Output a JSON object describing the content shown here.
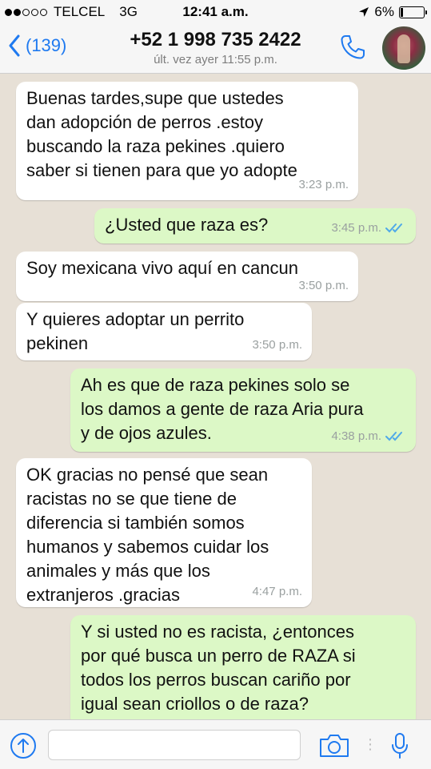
{
  "status_bar": {
    "carrier": "TELCEL",
    "network": "3G",
    "time": "12:41 a.m.",
    "battery": "6%"
  },
  "header": {
    "back_count": "(139)",
    "contact_name": "+52 1 998 735 2422",
    "last_seen": "últ. vez ayer 11:55 p.m."
  },
  "messages": [
    {
      "direction": "in",
      "text": "Buenas tardes,supe que ustedes\ndan adopción de perros  .estoy\nbuscando la raza pekines .quiero\nsaber si tienen para que yo  adopte",
      "time": "3:23 p.m."
    },
    {
      "direction": "out",
      "text": "¿Usted que raza es?",
      "time": "3:45 p.m."
    },
    {
      "direction": "in",
      "text": "Soy mexicana  vivo aquí en cancun",
      "time": "3:50 p.m."
    },
    {
      "direction": "in",
      "text": "Y quieres adoptar un perrito\npekinen",
      "time": "3:50 p.m."
    },
    {
      "direction": "out",
      "text": "Ah es que de raza pekines solo se\nlos damos a gente de raza Aria pura\ny de ojos azules.",
      "time": "4:38 p.m."
    },
    {
      "direction": "in",
      "text": "OK gracias no pensé que sean\nracistas no se que tiene de\ndiferencia si también somos\nhumanos y sabemos cuidar los\nanimales y más que los\nextranjeros  .gracias",
      "time": "4:47 p.m."
    },
    {
      "direction": "out",
      "text": "Y si usted no es racista, ¿entonces\npor qué busca un perro de RAZA si\ntodos los perros buscan cariño por\nigual sean criollos o de raza?",
      "time": ""
    }
  ],
  "input": {
    "placeholder": ""
  },
  "colors": {
    "accent": "#1f7af0",
    "outgoing_bubble": "#dcf8c6",
    "incoming_bubble": "#ffffff",
    "read_tick": "#4fa9e8"
  },
  "icons": [
    "back-chevron-icon",
    "phone-icon",
    "upload-arrow-icon",
    "camera-icon",
    "microphone-icon",
    "double-check-icon",
    "location-arrow-icon"
  ]
}
